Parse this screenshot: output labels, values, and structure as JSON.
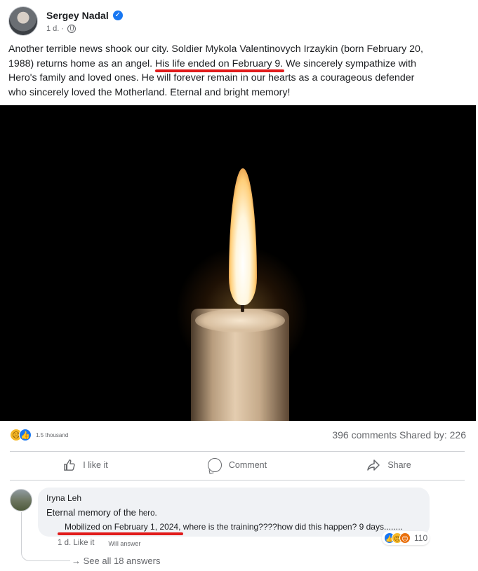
{
  "post": {
    "author": "Sergey Nadal",
    "time": "1 d. ·",
    "text_before": "Another terrible news shook our city. Soldier Mykola Valentinovych Irzaykin (born February 20, 1988) returns home as an angel.",
    "text_highlight": "His life ended on February 9.",
    "text_after": "We sincerely sympathize with Hero's family and loved ones. He will forever remain in our hearts as a courageous defender who sincerely loved the Motherland. Eternal and bright memory!"
  },
  "stats": {
    "reactions_count": "1.5 thousand",
    "comments_shared": "396 comments Shared by: 226"
  },
  "actions": {
    "like": "I like it",
    "comment": "Comment",
    "share": "Share"
  },
  "comment": {
    "author": "Iryna Leh",
    "line1_main": "Eternal memory of the",
    "line1_small": "hero.",
    "line2_highlight": "Mobilized on February 1, 2024,",
    "line2_rest": " where is the training????how did this happen? 9 days........",
    "reactions_count": "110",
    "time_like": "1 d. Like it",
    "reply": "Will answer",
    "see_all": "→ See all 18 answers"
  },
  "colors": {
    "accent": "#1877f2",
    "highlight_underline": "#e11b1b",
    "muted_text": "#65676b"
  }
}
